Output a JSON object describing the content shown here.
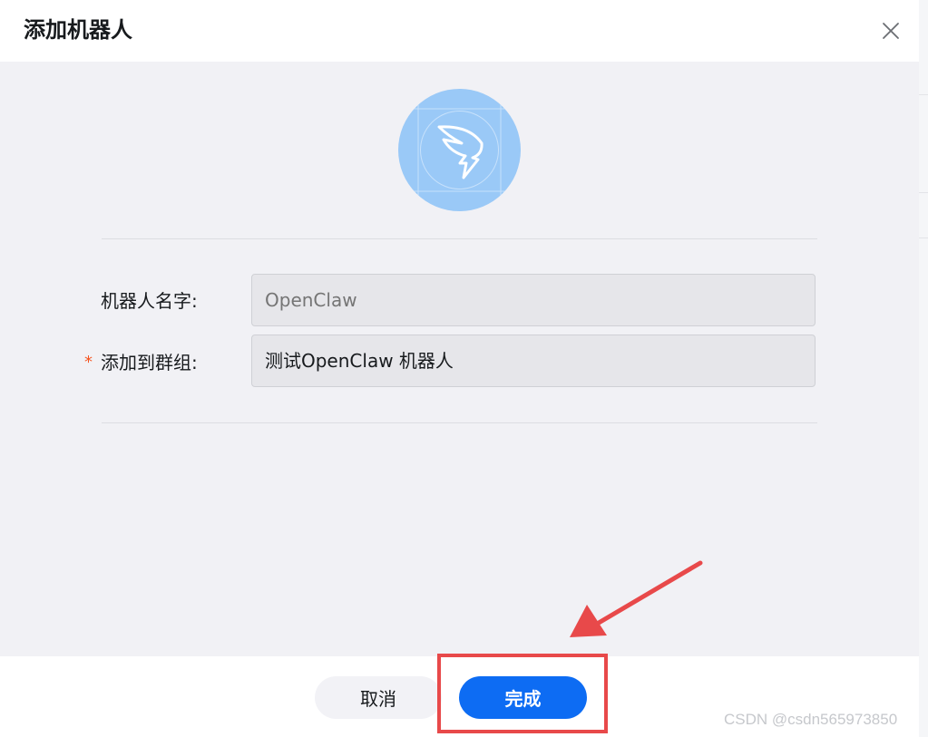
{
  "dialog": {
    "title": "添加机器人",
    "close_icon": "close-icon"
  },
  "avatar": {
    "icon": "dingtalk-wing-icon",
    "color": "#9ac9f7"
  },
  "form": {
    "robot_name_label": "机器人名字:",
    "robot_name_placeholder": "OpenClaw",
    "group_required_mark": "*",
    "group_label": "添加到群组:",
    "group_value": "测试OpenClaw 机器人"
  },
  "footer": {
    "cancel_label": "取消",
    "confirm_label": "完成"
  },
  "colors": {
    "primary": "#0d6cf3",
    "annotation_red": "#e8494a",
    "required_mark": "#f5541f",
    "body_bg": "#f1f1f5"
  },
  "watermark": "CSDN @csdn565973850"
}
